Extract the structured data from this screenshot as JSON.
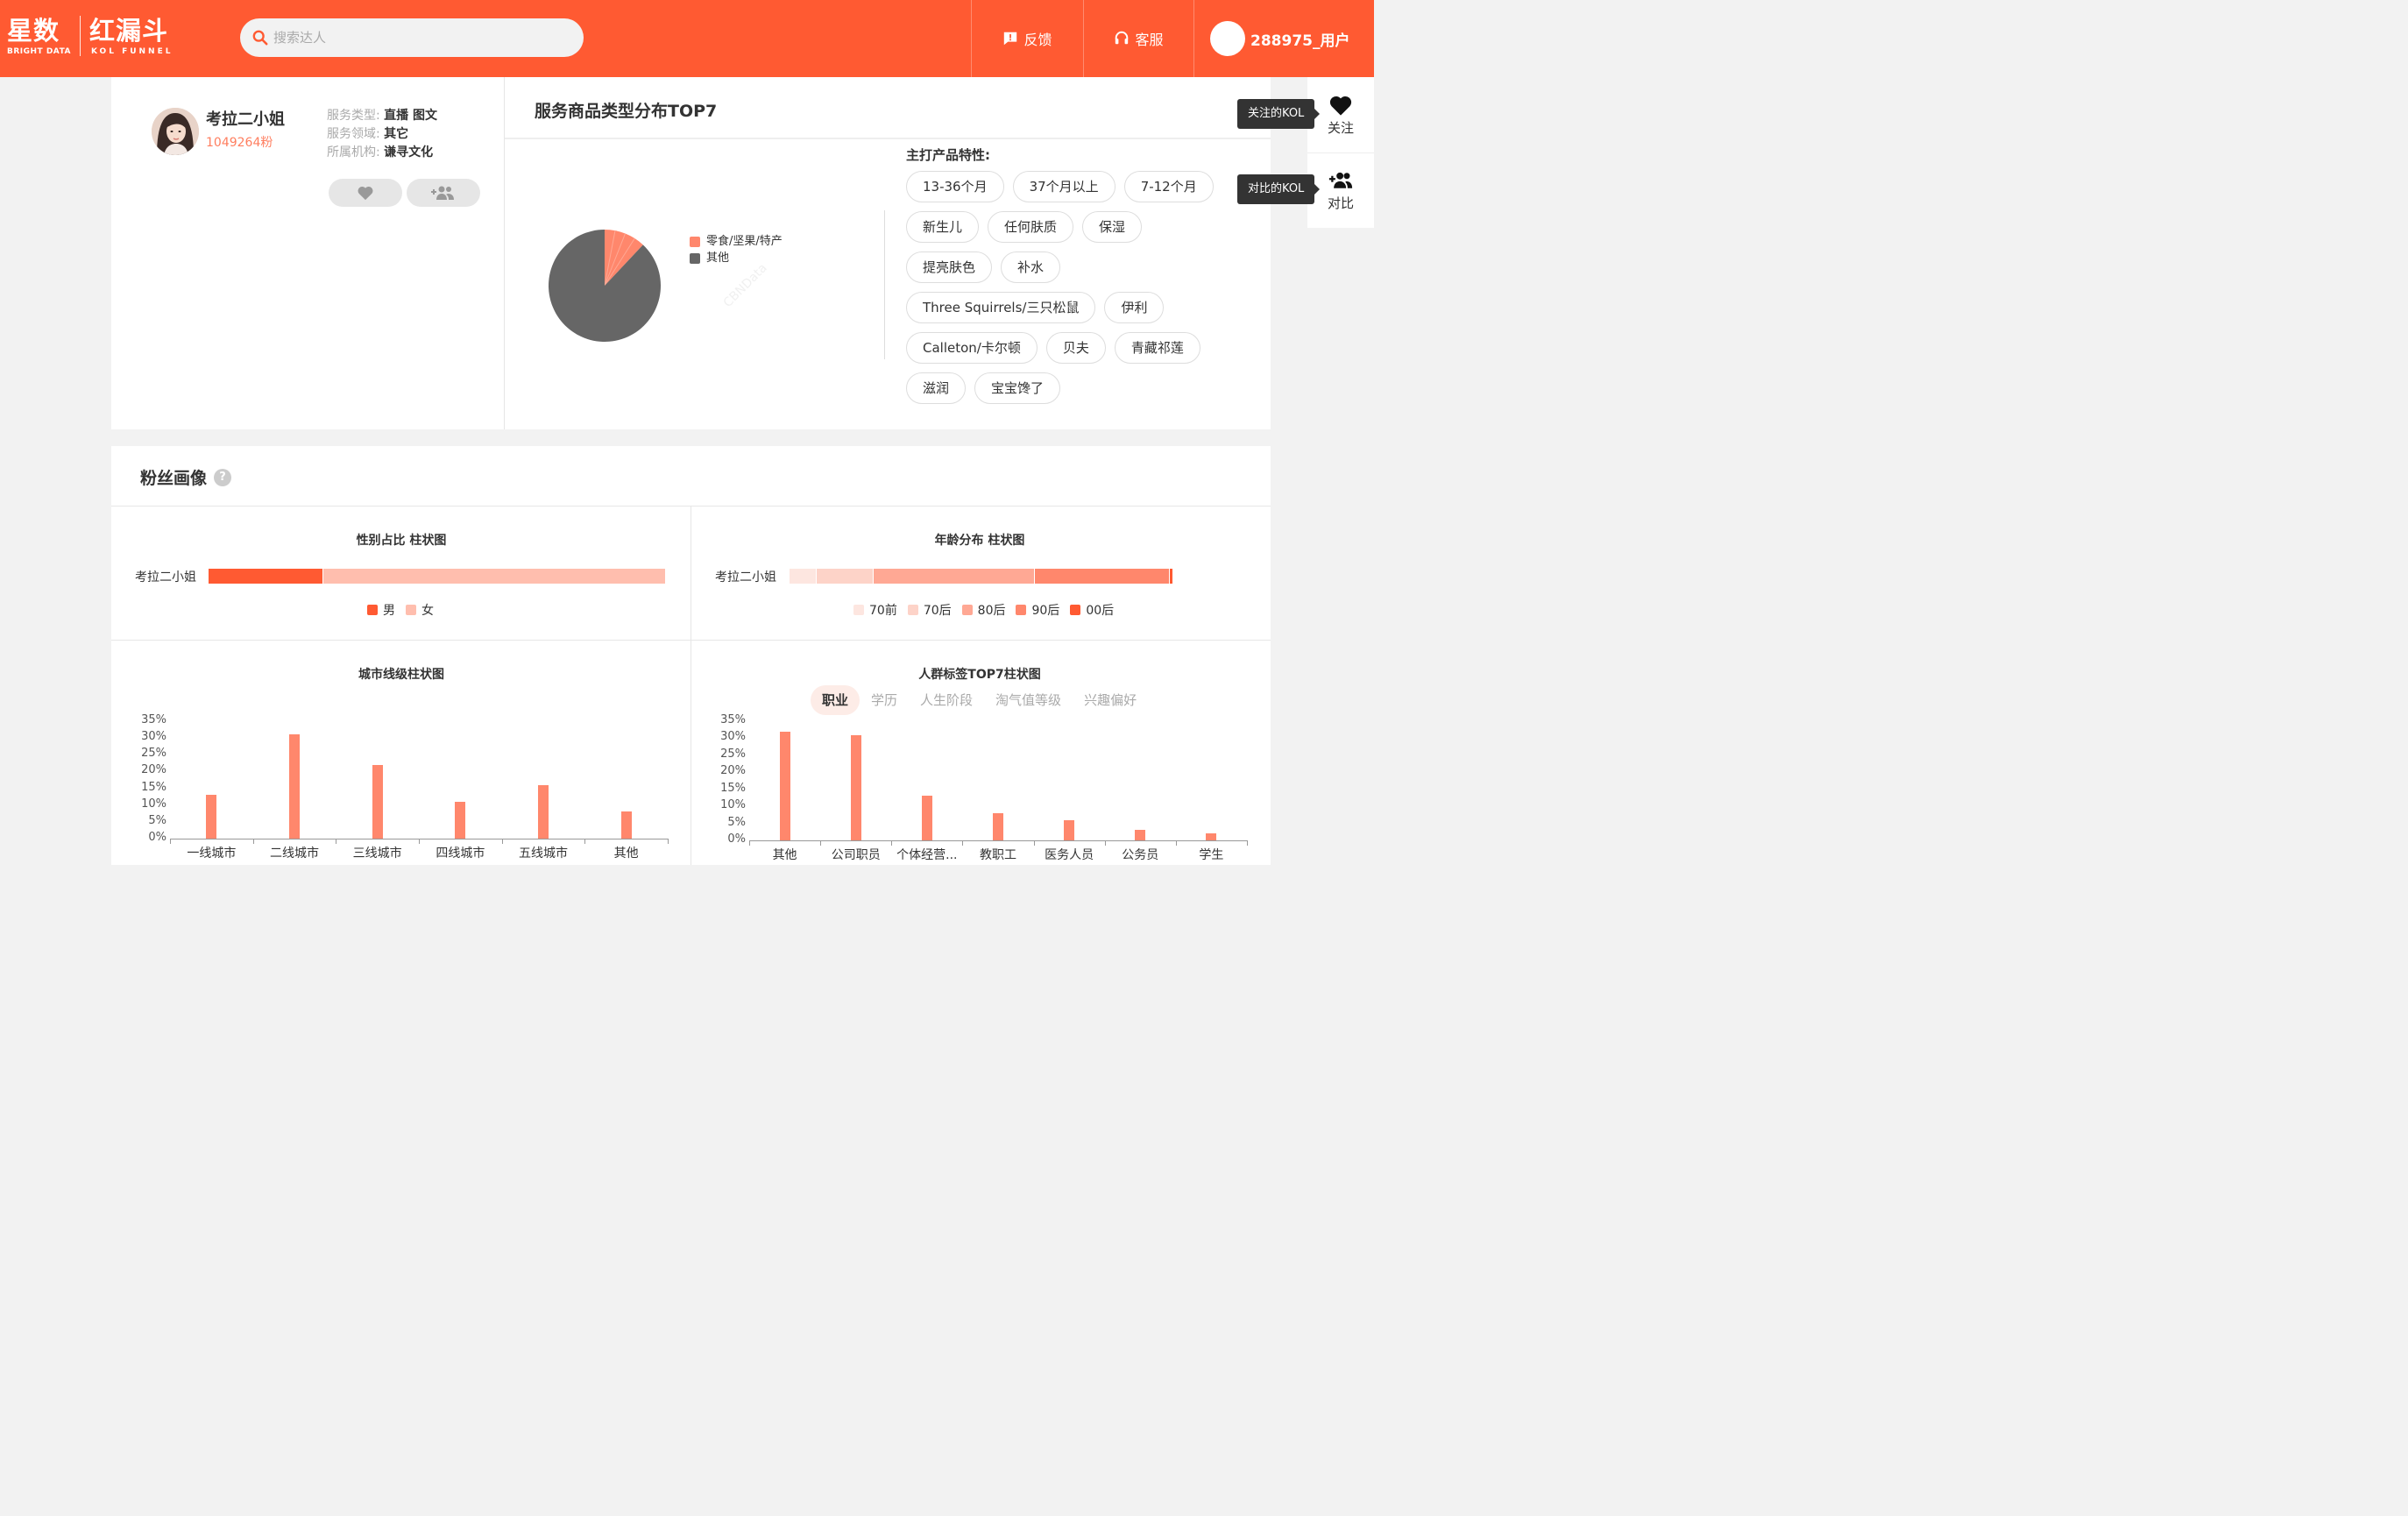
{
  "header": {
    "logo": {
      "cn1": "星数",
      "en1": "BRIGHT DATA",
      "cn2": "红漏斗",
      "en2": "KOL FUNNEL"
    },
    "search_placeholder": "搜索达人",
    "feedback": "反馈",
    "service": "客服",
    "user": "288975_用户",
    "brand_color": "#ff5a32"
  },
  "profile": {
    "name": "考拉二小姐",
    "fans": "1049264粉",
    "service_type_label": "服务类型:",
    "service_type": "直播 图文",
    "service_field_label": "服务领域:",
    "service_field": "其它",
    "org_label": "所属机构:",
    "org": "谦寻文化"
  },
  "dist": {
    "title": "服务商品类型分布TOP7",
    "tags_title": "主打产品特性:",
    "tags": [
      "13-36个月",
      "37个月以上",
      "7-12个月",
      "新生儿",
      "任何肤质",
      "保湿",
      "提亮肤色",
      "补水",
      "Three Squirrels/三只松鼠",
      "伊利",
      "Calleton/卡尔顿",
      "贝夫",
      "青藏祁莲",
      "滋润",
      "宝宝馋了"
    ]
  },
  "right_rail": {
    "follow": "关注",
    "follow_tip": "关注的KOL",
    "compare": "对比",
    "compare_tip": "对比的KOL"
  },
  "fans_section": {
    "title": "粉丝画像",
    "help": "?",
    "gender_title": "性别占比 柱状图",
    "age_title": "年龄分布  柱状图",
    "city_title": "城市线级柱状图",
    "crowd_title": "人群标签TOP7柱状图",
    "row_label": "考拉二小姐",
    "crowd_tabs": [
      "职业",
      "学历",
      "人生阶段",
      "淘气值等级",
      "兴趣偏好"
    ],
    "watermark": "CBNData"
  },
  "chart_data": [
    {
      "type": "pie",
      "title": "服务商品类型分布TOP7",
      "labels": [
        "零食/坚果/特产",
        "其他"
      ],
      "values": [
        12,
        88
      ],
      "colors": [
        "#ff876c",
        "#666666"
      ]
    },
    {
      "type": "bar",
      "orientation": "horizontal-stacked",
      "title": "性别占比 柱状图",
      "categories": [
        "考拉二小姐"
      ],
      "series": [
        {
          "name": "男",
          "values": [
            25
          ],
          "color": "#ff5a32"
        },
        {
          "name": "女",
          "values": [
            75
          ],
          "color": "#ffbeae"
        }
      ]
    },
    {
      "type": "bar",
      "orientation": "horizontal-stacked",
      "title": "年龄分布  柱状图",
      "categories": [
        "考拉二小姐"
      ],
      "series": [
        {
          "name": "70前",
          "values": [
            7
          ],
          "color": "#fde6e0"
        },
        {
          "name": "70后",
          "values": [
            15
          ],
          "color": "#fdd3c8"
        },
        {
          "name": "80后",
          "values": [
            42
          ],
          "color": "#ffa894"
        },
        {
          "name": "90后",
          "values": [
            35
          ],
          "color": "#ff876c"
        },
        {
          "name": "00后",
          "values": [
            1
          ],
          "color": "#ff5a32"
        }
      ]
    },
    {
      "type": "bar",
      "title": "城市线级柱状图",
      "categories": [
        "一线城市",
        "二线城市",
        "三线城市",
        "四线城市",
        "五线城市",
        "其他"
      ],
      "values": [
        13,
        31,
        22,
        11,
        16,
        8
      ],
      "yticks": [
        "0%",
        "5%",
        "10%",
        "15%",
        "20%",
        "25%",
        "30%",
        "35%"
      ],
      "ylim": [
        0,
        35
      ]
    },
    {
      "type": "bar",
      "title": "人群标签TOP7柱状图",
      "categories": [
        "其他",
        "公司职员",
        "个体经营...",
        "教职工",
        "医务人员",
        "公务员",
        "学生"
      ],
      "values": [
        32,
        31,
        13,
        8,
        6,
        3,
        2
      ],
      "yticks": [
        "0%",
        "5%",
        "10%",
        "15%",
        "20%",
        "25%",
        "30%",
        "35%"
      ],
      "ylim": [
        0,
        35
      ]
    }
  ]
}
